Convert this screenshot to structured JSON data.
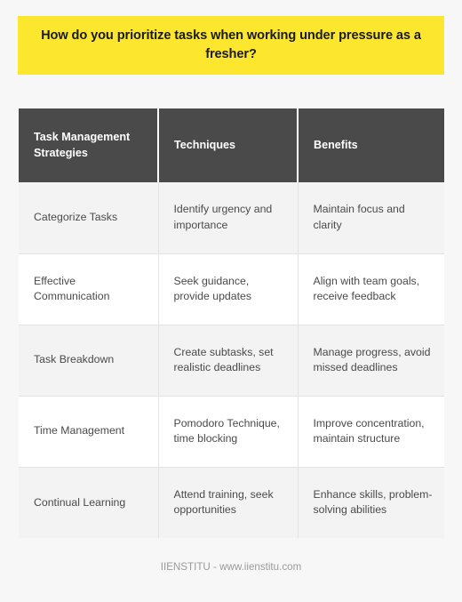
{
  "banner": {
    "title": "How do you prioritize tasks when working under pressure as a fresher?",
    "background_color": "#fce72e",
    "text_color": "#1a1a1a"
  },
  "table": {
    "header_background_color": "#4a4a4a",
    "header_text_color": "#ffffff",
    "columns": [
      "Task Management Strategies",
      "Techniques",
      "Benefits"
    ],
    "rows": [
      {
        "strategy": "Categorize Tasks",
        "technique": "Identify urgency and importance",
        "benefit": "Maintain focus and clarity"
      },
      {
        "strategy": "Effective Communication",
        "technique": "Seek guidance, provide updates",
        "benefit": "Align with team goals, receive feedback"
      },
      {
        "strategy": "Task Breakdown",
        "technique": "Create subtasks, set realistic deadlines",
        "benefit": "Manage progress, avoid missed deadlines"
      },
      {
        "strategy": "Time Management",
        "technique": "Pomodoro Technique, time blocking",
        "benefit": "Improve concentration, maintain structure"
      },
      {
        "strategy": "Continual Learning",
        "technique": "Attend training, seek opportunities",
        "benefit": "Enhance skills, problem-solving abilities"
      }
    ]
  },
  "footer": {
    "text": "IIENSTITU - www.iienstitu.com",
    "text_color": "#9a9a9a"
  }
}
